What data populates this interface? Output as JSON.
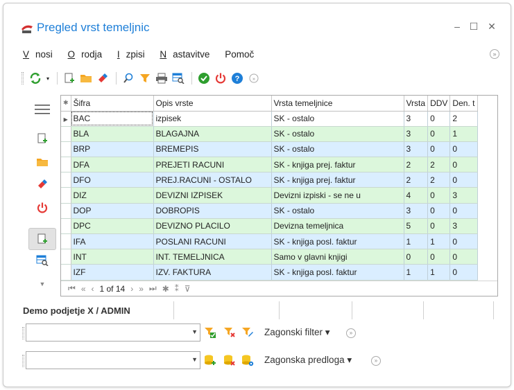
{
  "window": {
    "title": "Pregled vrst temeljnic",
    "minimize": "–",
    "maximize": "☐",
    "close": "✕"
  },
  "menu": {
    "items": [
      {
        "label": "Vnosi",
        "accel": "V",
        "rest": "nosi"
      },
      {
        "label": "Orodja",
        "accel": "O",
        "rest": "rodja"
      },
      {
        "label": "Izpisi",
        "accel": "I",
        "rest": "zpisi"
      },
      {
        "label": "Nastavitve",
        "accel": "N",
        "rest": "astavitve"
      },
      {
        "label": "Pomoč",
        "accel": "",
        "rest": "Pomoč"
      }
    ]
  },
  "grid": {
    "columns": [
      "Šifra",
      "Opis vrste",
      "Vrsta temeljnice",
      "Vrsta",
      "DDV",
      "Den. t"
    ],
    "rows": [
      {
        "sifra": "BAC",
        "opis": "izpisek",
        "vrsta_tem": "SK - ostalo",
        "vrsta": "3",
        "ddv": "0",
        "den": "2",
        "color": "white",
        "current": true
      },
      {
        "sifra": "BLA",
        "opis": "BLAGAJNA",
        "vrsta_tem": "SK - ostalo",
        "vrsta": "3",
        "ddv": "0",
        "den": "1",
        "color": "green"
      },
      {
        "sifra": "BRP",
        "opis": "BREMEPIS",
        "vrsta_tem": "SK - ostalo",
        "vrsta": "3",
        "ddv": "0",
        "den": "0",
        "color": "blue"
      },
      {
        "sifra": "DFA",
        "opis": "PREJETI RACUNI",
        "vrsta_tem": "SK - knjiga prej. faktur",
        "vrsta": "2",
        "ddv": "2",
        "den": "0",
        "color": "green"
      },
      {
        "sifra": "DFO",
        "opis": "PREJ.RACUNI - OSTALO",
        "vrsta_tem": "SK - knjiga prej. faktur",
        "vrsta": "2",
        "ddv": "2",
        "den": "0",
        "color": "blue"
      },
      {
        "sifra": "DIZ",
        "opis": "DEVIZNI IZPISEK",
        "vrsta_tem": "Devizni izpiski - se ne u",
        "vrsta": "4",
        "ddv": "0",
        "den": "3",
        "color": "green"
      },
      {
        "sifra": "DOP",
        "opis": "DOBROPIS",
        "vrsta_tem": "SK - ostalo",
        "vrsta": "3",
        "ddv": "0",
        "den": "0",
        "color": "blue"
      },
      {
        "sifra": "DPC",
        "opis": "DEVIZNO PLACILO",
        "vrsta_tem": "Devizna temeljnica",
        "vrsta": "5",
        "ddv": "0",
        "den": "3",
        "color": "green"
      },
      {
        "sifra": "IFA",
        "opis": "POSLANI RACUNI",
        "vrsta_tem": "SK - knjiga posl. faktur",
        "vrsta": "1",
        "ddv": "1",
        "den": "0",
        "color": "blue"
      },
      {
        "sifra": "INT",
        "opis": "INT. TEMELJNICA",
        "vrsta_tem": "Samo v glavni knjigi",
        "vrsta": "0",
        "ddv": "0",
        "den": "0",
        "color": "green"
      },
      {
        "sifra": "IZF",
        "opis": "IZV. FAKTURA",
        "vrsta_tem": "SK - knjiga posl. faktur",
        "vrsta": "1",
        "ddv": "1",
        "den": "0",
        "color": "blue"
      }
    ]
  },
  "navigator": {
    "page": "1 of 14"
  },
  "status": {
    "company": "Demo podjetje X / ADMIN"
  },
  "filter": {
    "value": "",
    "label": "Zagonski filter ▾"
  },
  "template": {
    "value": "",
    "label": "Zagonska predloga ▾"
  },
  "colors": {
    "accent": "#1e7fd8",
    "row_blue": "#daeeff",
    "row_green": "#dcf7dc",
    "refresh": "#2e9e2e",
    "power": "#e53935"
  }
}
